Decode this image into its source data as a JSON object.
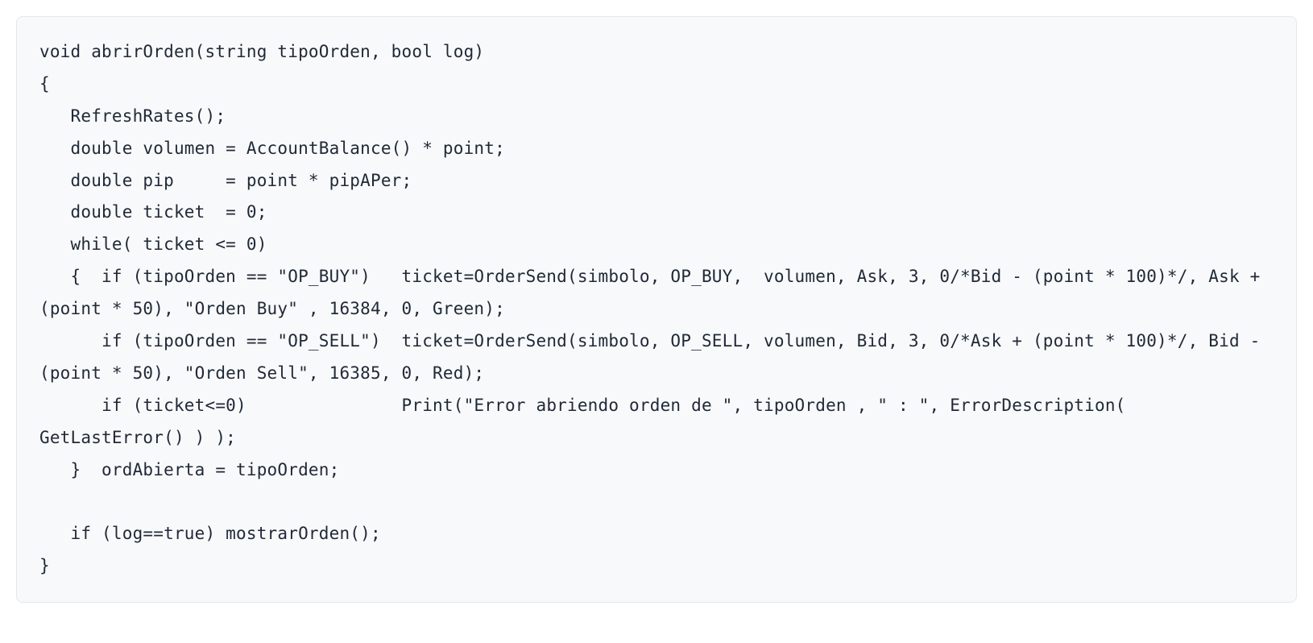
{
  "code": {
    "line1": "void abrirOrden(string tipoOrden, bool log)",
    "line2": "{",
    "line3": "   RefreshRates();",
    "line4": "   double volumen = AccountBalance() * point;",
    "line5": "   double pip     = point * pipAPer;",
    "line6": "   double ticket  = 0;",
    "line7": "   while( ticket <= 0)",
    "line8": "   {  if (tipoOrden == \"OP_BUY\")   ticket=OrderSend(simbolo, OP_BUY,  volumen, Ask, 3, 0/*Bid - (point * 100)*/, Ask + (point * 50), \"Orden Buy\" , 16384, 0, Green);",
    "line9": "      if (tipoOrden == \"OP_SELL\")  ticket=OrderSend(simbolo, OP_SELL, volumen, Bid, 3, 0/*Ask + (point * 100)*/, Bid - (point * 50), \"Orden Sell\", 16385, 0, Red);",
    "line10": "      if (ticket<=0)               Print(\"Error abriendo orden de \", tipoOrden , \" : \", ErrorDescription( GetLastError() ) );",
    "line11": "   }  ordAbierta = tipoOrden;",
    "line12": "",
    "line13": "   if (log==true) mostrarOrden();",
    "line14": "}"
  }
}
